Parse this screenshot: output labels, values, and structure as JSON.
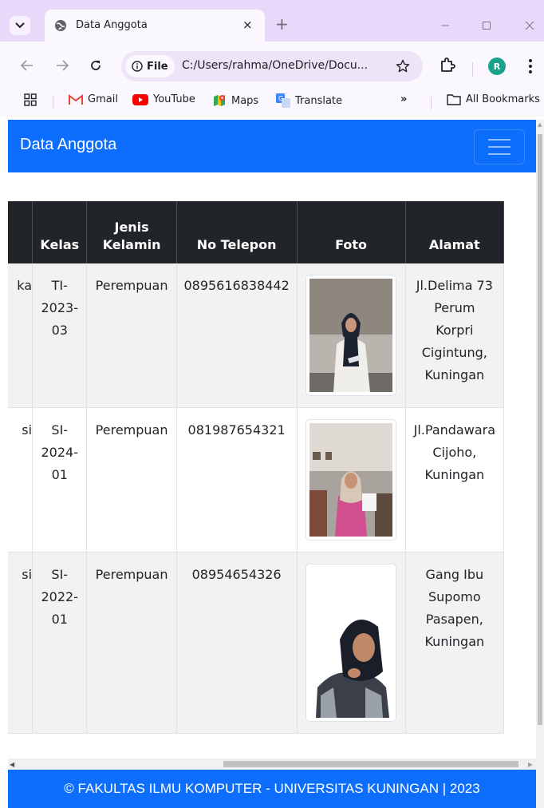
{
  "browser": {
    "tab_title": "Data Anggota",
    "tab_close": "×",
    "new_tab": "+",
    "site_chip": "File",
    "url": "C:/Users/rahma/OneDrive/Docu...",
    "profile_initial": "R",
    "bookmarks": [
      {
        "label": "Gmail",
        "icon": "gmail-icon"
      },
      {
        "label": "YouTube",
        "icon": "youtube-icon"
      },
      {
        "label": "Maps",
        "icon": "maps-icon"
      },
      {
        "label": "Translate",
        "icon": "translate-icon"
      }
    ],
    "bookmarks_more": "»",
    "all_bookmarks": "All Bookmarks"
  },
  "navbar": {
    "brand": "Data Anggota"
  },
  "table": {
    "headers": {
      "kelas": "Kelas",
      "jenis_kelamin_1": "Jenis",
      "jenis_kelamin_2": "Kelamin",
      "no_telepon": "No Telepon",
      "foto": "Foto",
      "alamat": "Alamat"
    },
    "rows": [
      {
        "prodi_fragment": "ka",
        "kelas": [
          "TI-",
          "2023-",
          "03"
        ],
        "jenis_kelamin": "Perempuan",
        "no_telepon": "0895616838442",
        "alamat": [
          "Jl.Delima 73",
          "Perum",
          "Korpri",
          "Cigintung,",
          "Kuningan"
        ]
      },
      {
        "prodi_fragment": "si",
        "kelas": [
          "SI-",
          "2024-",
          "01"
        ],
        "jenis_kelamin": "Perempuan",
        "no_telepon": "081987654321",
        "alamat": [
          "Jl.Pandawara",
          "Cijoho,",
          "Kuningan"
        ]
      },
      {
        "prodi_fragment": "si",
        "kelas": [
          "SI-",
          "2022-",
          "01"
        ],
        "jenis_kelamin": "Perempuan",
        "no_telepon": "08954654326",
        "alamat": [
          "Gang Ibu",
          "Supomo",
          "Pasapen,",
          "Kuningan"
        ]
      }
    ]
  },
  "footer": {
    "text": "© FAKULTAS ILMU KOMPUTER - UNIVERSITAS KUNINGAN | 2023"
  },
  "colors": {
    "primary": "#0d6efd",
    "table_header": "#212529",
    "tabstrip": "#e8d9fb"
  }
}
